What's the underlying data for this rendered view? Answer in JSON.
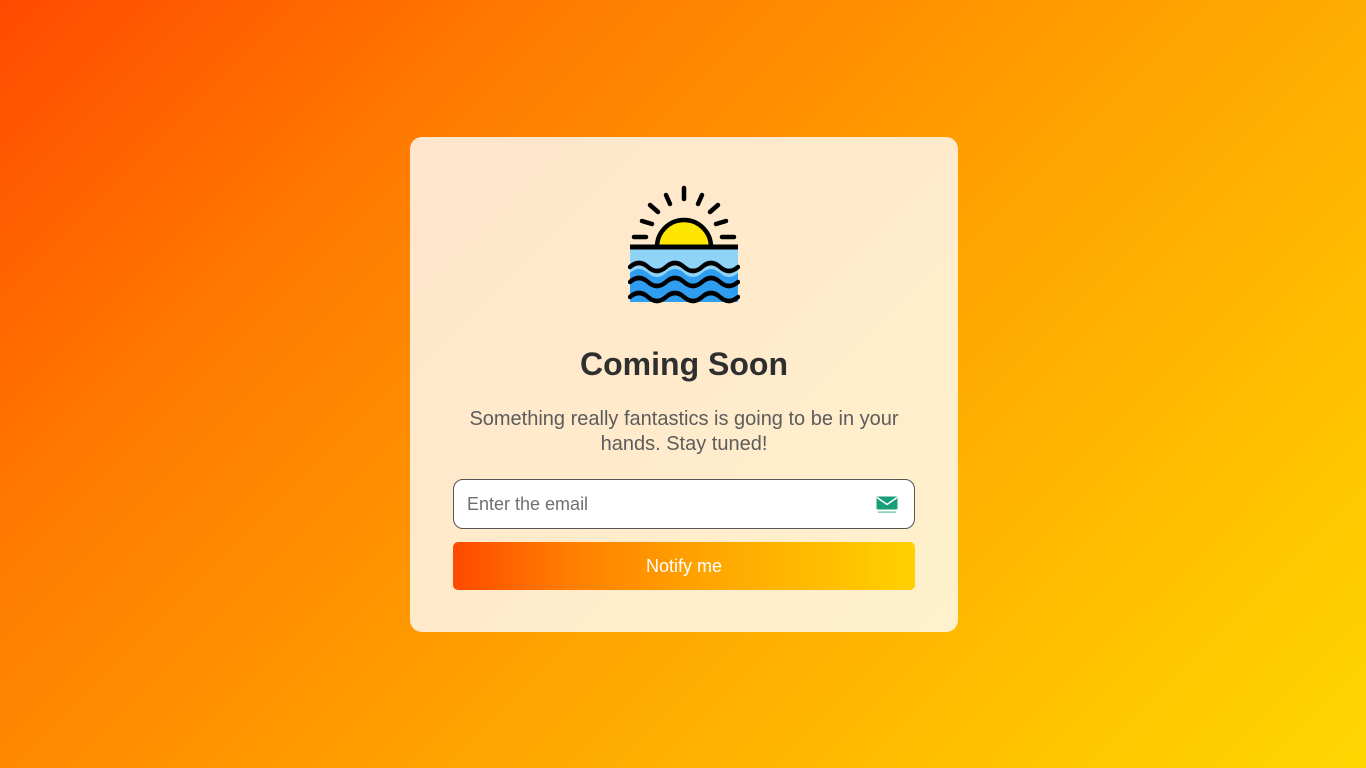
{
  "page": {
    "title": "Coming Soon",
    "subtitle": "Something really fantastics is going to be in your hands. Stay tuned!"
  },
  "logo": {
    "icon": "sunset-over-sea-icon"
  },
  "form": {
    "email_placeholder": "Enter the email",
    "email_value": "",
    "email_icon": "envelope-icon",
    "submit_label": "Notify me"
  },
  "colors": {
    "background_start": "#ff4a00",
    "background_end": "#ffd600",
    "card_background": "#fef0d8",
    "title_color": "#2f2f2f",
    "subtitle_color": "#5c5c5c",
    "sun_color": "#ffe600",
    "water_light": "#8fd3f7",
    "water_dark": "#2f9ef0",
    "envelope_color": "#1a9e7a"
  }
}
